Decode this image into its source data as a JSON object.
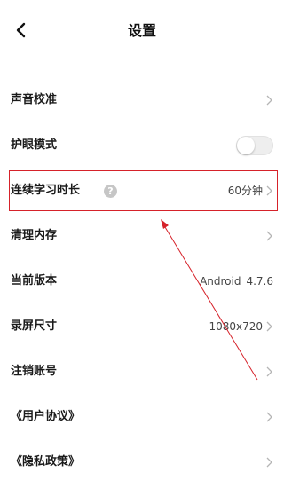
{
  "header": {
    "title": "设置",
    "back_icon": "chevron-left-icon"
  },
  "settings": {
    "sound_calibration": {
      "label": "声音校准"
    },
    "eye_care": {
      "label": "护眼模式",
      "enabled": false
    },
    "continuous_study": {
      "label": "连续学习时长",
      "value": "60分钟",
      "help_icon": "question-icon",
      "help_glyph": "?"
    },
    "clear_memory": {
      "label": "清理内存"
    },
    "current_version": {
      "label": "当前版本",
      "value": "Android_4.7.6"
    },
    "recording_size": {
      "label": "录屏尺寸",
      "value": "1080x720"
    },
    "cancel_account": {
      "label": "注销账号"
    },
    "user_agreement": {
      "label": "《用户协议》"
    },
    "privacy_policy": {
      "label": "《隐私政策》"
    }
  },
  "colors": {
    "highlight": "#d6222a",
    "chevron": "#b5b5b5",
    "text": "#1a1a1a"
  }
}
